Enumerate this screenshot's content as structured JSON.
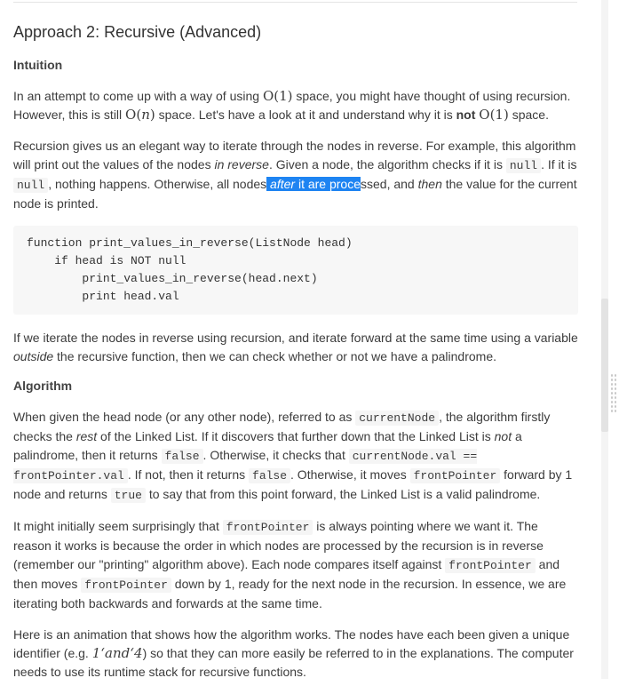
{
  "section": {
    "title": "Approach 2: Recursive (Advanced)"
  },
  "intuition": {
    "heading": "Intuition",
    "p1": {
      "a": "In an attempt to come up with a way of using ",
      "m1_open": "O(",
      "m1_arg": "1",
      "m1_close": ")",
      "b": " space, you might have thought of using recursion. However, this is still ",
      "m2_open": "O(",
      "m2_arg": "n",
      "m2_close": ")",
      "c": " space. Let's have a look at it and understand why it is ",
      "bold": "not",
      "m3_open": "O(",
      "m3_arg": "1",
      "m3_close": ")",
      "d": " space."
    },
    "p2": {
      "a": "Recursion gives us an elegant way to iterate through the nodes in reverse. For example, this algorithm will print out the values of the nodes ",
      "em1": "in reverse",
      "b": ". Given a node, the algorithm checks if it is ",
      "code1": "null",
      "c": ". If it is ",
      "code2": "null",
      "d": ", nothing happens. Otherwise, all nodes",
      "sel_em": "after",
      "sel_text": " it are proce",
      "e": "ssed, and ",
      "em2": "then",
      "f": " the value for the current node is printed."
    },
    "code_lines": [
      "function print_values_in_reverse(ListNode head)",
      "    if head is NOT null",
      "        print_values_in_reverse(head.next)",
      "        print head.val"
    ],
    "p3": {
      "a": "If we iterate the nodes in reverse using recursion, and iterate forward at the same time using a variable ",
      "em": "outside",
      "b": " the recursive function, then we can check whether or not we have a palindrome."
    }
  },
  "algorithm": {
    "heading": "Algorithm",
    "p1": {
      "a": "When given the head node (or any other node), referred to as ",
      "code1": "currentNode",
      "b": ", the algorithm firstly checks the ",
      "em1": "rest",
      "c": " of the Linked List. If it discovers that further down that the Linked List is ",
      "em2": "not",
      "d": " a palindrome, then it returns ",
      "code2": "false",
      "e": ". Otherwise, it checks that ",
      "code3": "currentNode.val == frontPointer.val",
      "f": ". If not, then it returns ",
      "code4": "false",
      "g": ". Otherwise, it moves ",
      "code5": "frontPointer",
      "h": " forward by 1 node and returns ",
      "code6": "true",
      "i": " to say that from this point forward, the Linked List is a valid palindrome."
    },
    "p2": {
      "a": "It might initially seem surprisingly that ",
      "code1": "frontPointer",
      "b": " is always pointing where we want it. The reason it works is because the order in which nodes are processed by the recursion is in reverse (remember our \"printing\" algorithm above). Each node compares itself against ",
      "code2": "frontPointer",
      "c": " and then moves ",
      "code3": "frontPointer",
      "d": " down by 1, ready for the next node in the recursion. In essence, we are iterating both backwards and forwards at the same time."
    },
    "p3": {
      "a": "Here is an animation that shows how the algorithm works. The nodes have each been given a unique identifier (e.g. ",
      "math": "1‘and‘4",
      "b": ") so that they can more easily be referred to in the explanations. The computer needs to use its runtime stack for recursive functions."
    }
  }
}
